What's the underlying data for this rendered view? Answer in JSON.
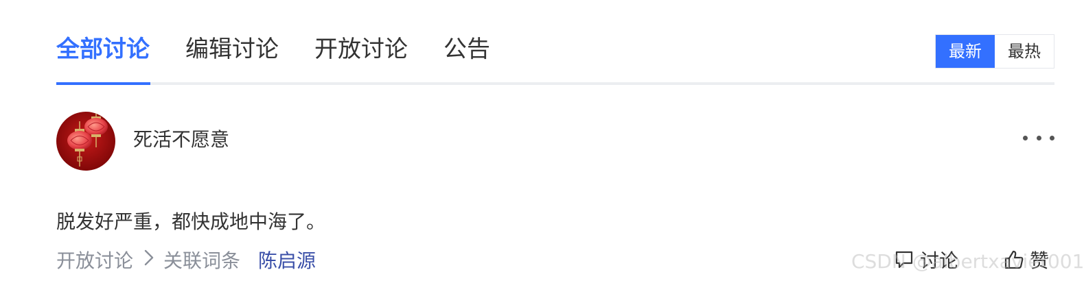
{
  "tabs": [
    {
      "label": "全部讨论",
      "active": true
    },
    {
      "label": "编辑讨论",
      "active": false
    },
    {
      "label": "开放讨论",
      "active": false
    },
    {
      "label": "公告",
      "active": false
    }
  ],
  "sort": {
    "newest": "最新",
    "hottest": "最热",
    "selected": "最新"
  },
  "post": {
    "author": "死活不愿意",
    "avatar_icon": "red-lanterns-avatar",
    "text": "脱发好严重，都快成地中海了。",
    "category": "开放讨论",
    "separator_icon": "chevron-right-icon",
    "related_label": "关联词条",
    "related_entry": "陈启源",
    "discuss_label": "讨论",
    "like_label": "赞"
  },
  "watermark": "CSDN @albertxavier001",
  "colors": {
    "accent": "#3370ff",
    "link": "#3a4fa8",
    "muted": "#8a8f99",
    "text": "#333333"
  }
}
